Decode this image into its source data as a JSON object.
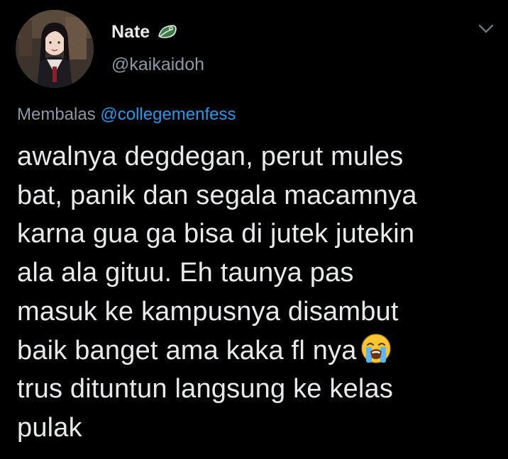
{
  "author": {
    "display_name": "Nate",
    "handle": "@kaikaidoh",
    "avatar_icon": "profile-photo",
    "badge_icon": "leaf-icon",
    "badge_color": "#3a7d44"
  },
  "reply": {
    "prefix": "Membalas",
    "mention": "@collegemenfess",
    "mention_color": "#1d9bf0"
  },
  "tweet": {
    "lines": [
      "awalnya degdegan, perut mules",
      "bat, panik dan segala macamnya",
      "karna gua ga bisa di jutek jutekin",
      "ala ala gituu. Eh taunya pas",
      "masuk ke kampusnya disambut",
      "baik banget ama kaka fl nya",
      "trus dituntun langsung ke kelas",
      "pulak"
    ],
    "emoji": "loudly-crying-face-icon"
  },
  "menu": {
    "icon": "chevron-down-icon"
  },
  "colors": {
    "background": "#000000",
    "primary_text": "#e7e9ea",
    "secondary_text": "#8b98a5"
  }
}
